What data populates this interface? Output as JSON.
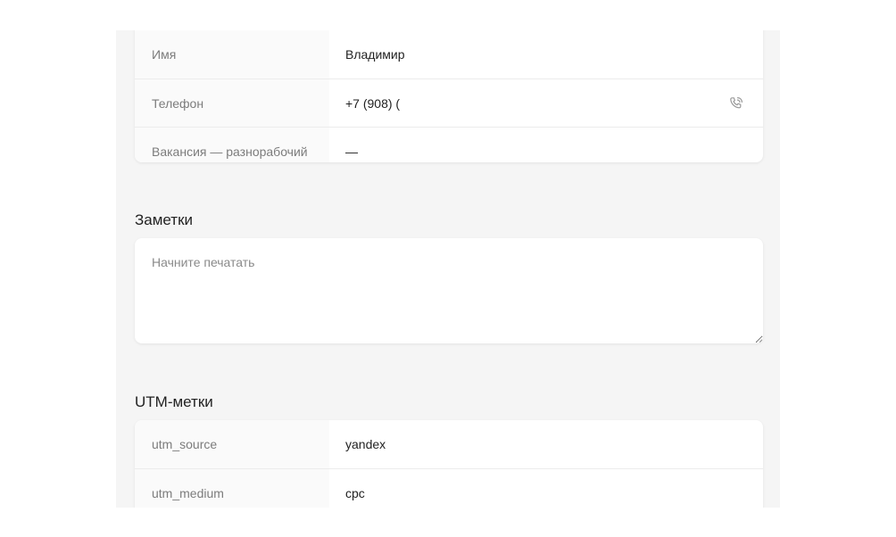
{
  "contact": {
    "rows": [
      {
        "label": "Имя",
        "value": "Владимир"
      },
      {
        "label": "Телефон",
        "value": "+7 (908) (",
        "icon": "phone-call-icon"
      },
      {
        "label": "Вакансия — разнорабочий",
        "value": "—"
      }
    ]
  },
  "notes": {
    "title": "Заметки",
    "placeholder": "Начните печатать"
  },
  "utm": {
    "title": "UTM-метки",
    "rows": [
      {
        "label": "utm_source",
        "value": "yandex"
      },
      {
        "label": "utm_medium",
        "value": "cpc"
      }
    ]
  },
  "colors": {
    "panel_bg": "#f5f5f5",
    "card_bg": "#ffffff",
    "label_bg": "#fafafa",
    "label_text": "#7c7c7c",
    "value_text": "#222222"
  }
}
